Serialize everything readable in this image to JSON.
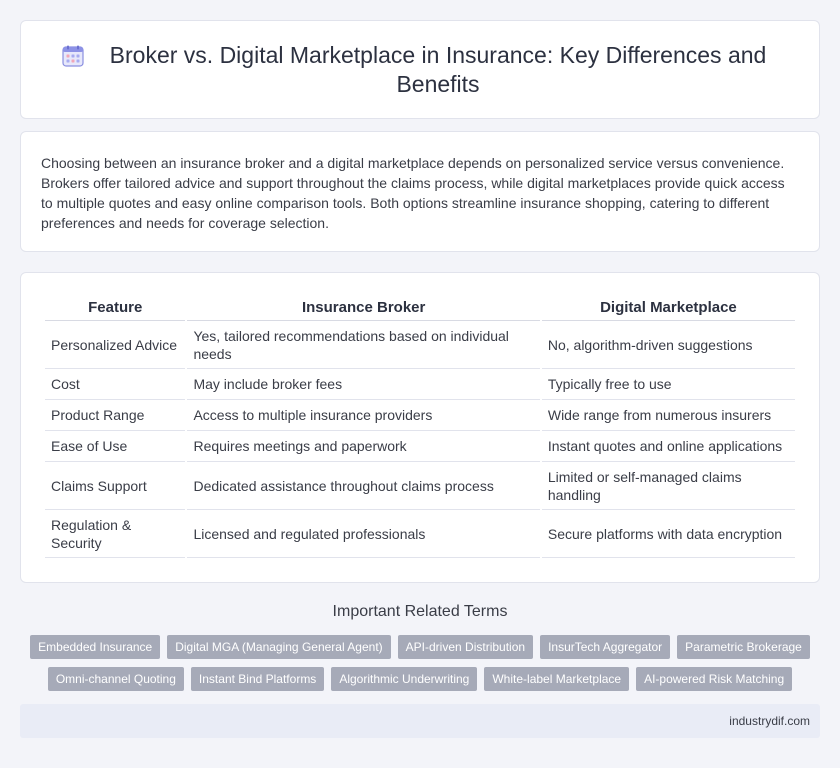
{
  "header": {
    "title": "Broker vs. Digital Marketplace in Insurance: Key Differences and Benefits",
    "icon": "calendar-grid-icon",
    "icon_color": "#7a7fd6"
  },
  "intro": {
    "text": "Choosing between an insurance broker and a digital marketplace depends on personalized service versus convenience. Brokers offer tailored advice and support throughout the claims process, while digital marketplaces provide quick access to multiple quotes and easy online comparison tools. Both options streamline insurance shopping, catering to different preferences and needs for coverage selection."
  },
  "table": {
    "headers": [
      "Feature",
      "Insurance Broker",
      "Digital Marketplace"
    ],
    "rows": [
      [
        "Personalized Advice",
        "Yes, tailored recommendations based on individual needs",
        "No, algorithm-driven suggestions"
      ],
      [
        "Cost",
        "May include broker fees",
        "Typically free to use"
      ],
      [
        "Product Range",
        "Access to multiple insurance providers",
        "Wide range from numerous insurers"
      ],
      [
        "Ease of Use",
        "Requires meetings and paperwork",
        "Instant quotes and online applications"
      ],
      [
        "Claims Support",
        "Dedicated assistance throughout claims process",
        "Limited or self-managed claims handling"
      ],
      [
        "Regulation & Security",
        "Licensed and regulated professionals",
        "Secure platforms with data encryption"
      ]
    ]
  },
  "related": {
    "title": "Important Related Terms",
    "tags": [
      "Embedded Insurance",
      "Digital MGA (Managing General Agent)",
      "API-driven Distribution",
      "InsurTech Aggregator",
      "Parametric Brokerage",
      "Omni-channel Quoting",
      "Instant Bind Platforms",
      "Algorithmic Underwriting",
      "White-label Marketplace",
      "AI-powered Risk Matching"
    ]
  },
  "footer": {
    "site": "industrydif.com"
  }
}
